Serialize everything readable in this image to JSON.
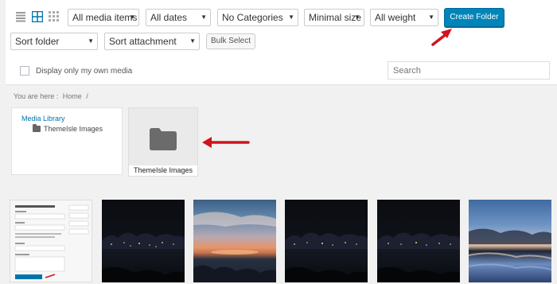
{
  "toolbar": {
    "views": [
      {
        "icon": "list-view-icon"
      },
      {
        "icon": "grid-view-icon"
      },
      {
        "icon": "small-grid-view-icon"
      }
    ],
    "filters": {
      "media_type": "All media items",
      "dates": "All dates",
      "categories": "No Categories",
      "size": "Minimal size",
      "weight": "All weight"
    },
    "create_folder_label": "Create Folder",
    "sort_folder": "Sort folder",
    "sort_attachment": "Sort attachment",
    "bulk_select_label": "Bulk Select",
    "own_media_label": "Display only my own media",
    "search_placeholder": "Search"
  },
  "breadcrumb": {
    "prefix": "You are here :",
    "current": "Home",
    "separator": "/"
  },
  "tree": {
    "root": "Media Library",
    "children": [
      "ThemeIsle Images"
    ]
  },
  "folders": [
    {
      "name": "ThemeIsle Images",
      "icon": "folder-icon"
    }
  ],
  "gallery": [
    {
      "kind": "screenshot"
    },
    {
      "kind": "night-coast-photo"
    },
    {
      "kind": "sunset-coast-photo"
    },
    {
      "kind": "night-coast-photo"
    },
    {
      "kind": "night-coast-photo"
    },
    {
      "kind": "sunset-reflection-photo"
    }
  ],
  "colors": {
    "primary": "#0085ba",
    "arrow": "#d0141c",
    "link": "#0073aa"
  }
}
